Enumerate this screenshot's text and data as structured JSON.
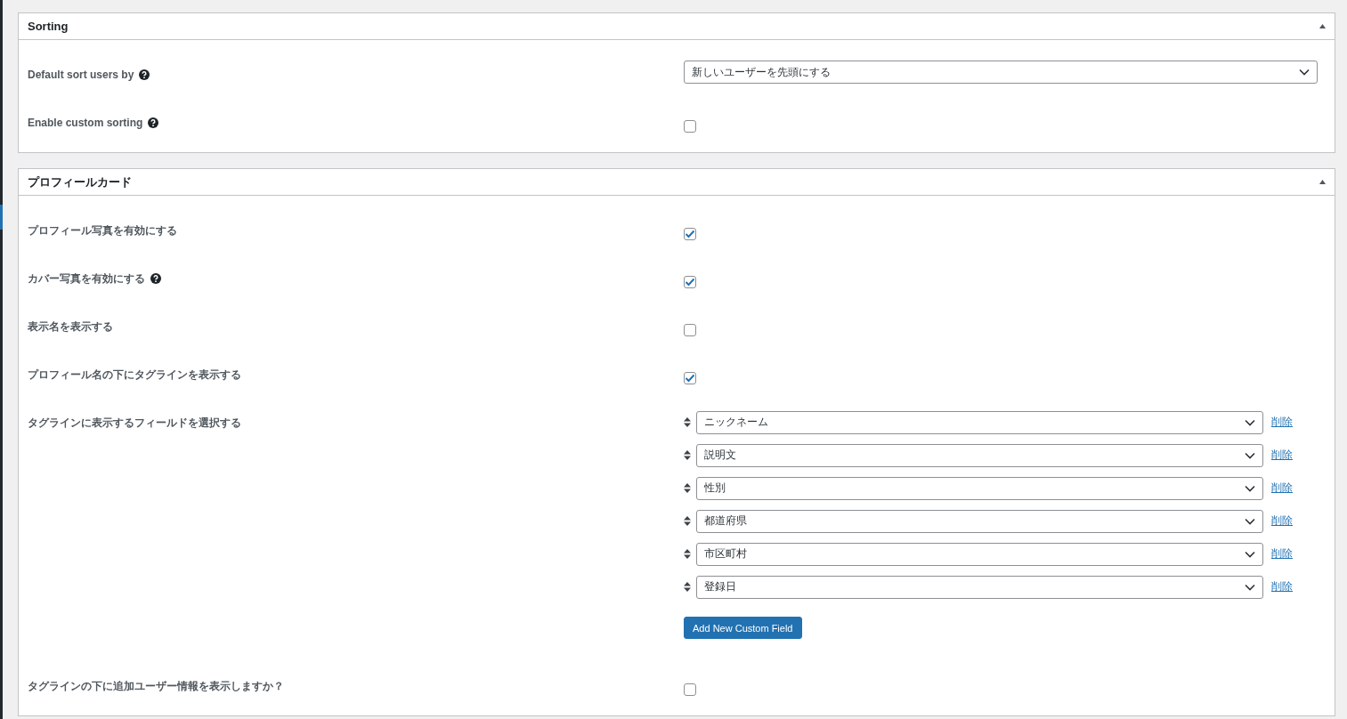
{
  "panels": [
    {
      "title": "Sorting",
      "rows": [
        {
          "kind": "select",
          "label": "Default sort users by",
          "help": true,
          "value": "新しいユーザーを先頭にする"
        },
        {
          "kind": "checkbox",
          "label": "Enable custom sorting",
          "help": true,
          "checked": false
        }
      ]
    },
    {
      "title": "プロフィールカード",
      "rows": [
        {
          "kind": "checkbox",
          "label": "プロフィール写真を有効にする",
          "help": false,
          "checked": true
        },
        {
          "kind": "checkbox",
          "label": "カバー写真を有効にする",
          "help": true,
          "checked": true
        },
        {
          "kind": "checkbox",
          "label": "表示名を表示する",
          "help": false,
          "checked": false
        },
        {
          "kind": "checkbox",
          "label": "プロフィール名の下にタグラインを表示する",
          "help": false,
          "checked": true
        },
        {
          "kind": "field_list",
          "label": "タグラインに表示するフィールドを選択する",
          "help": false,
          "fields": [
            {
              "value": "ニックネーム",
              "remove": "削除"
            },
            {
              "value": "説明文",
              "remove": "削除"
            },
            {
              "value": "性別",
              "remove": "削除"
            },
            {
              "value": "都道府県",
              "remove": "削除"
            },
            {
              "value": "市区町村",
              "remove": "削除"
            },
            {
              "value": "登録日",
              "remove": "削除"
            }
          ],
          "button": "Add New Custom Field"
        },
        {
          "kind": "checkbox",
          "label": "タグラインの下に追加ユーザー情報を表示しますか？",
          "help": false,
          "checked": false
        }
      ]
    }
  ]
}
